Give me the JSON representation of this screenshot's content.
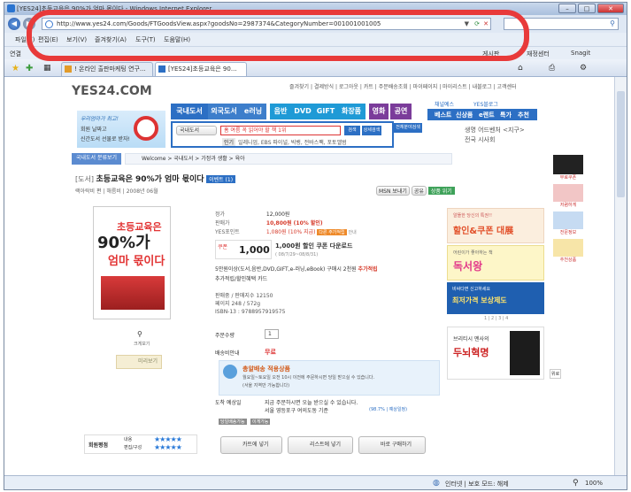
{
  "window": {
    "title": "[YES24]초등교육은 90%가 엄마 몫이다 - Windows Internet Explorer",
    "address": "http://www.yes24.com/Goods/FTGoodsView.aspx?goodsNo=2987374&CategoryNumber=001001001005"
  },
  "menu": [
    "파일(F)",
    "편집(E)",
    "보기(V)",
    "즐겨찾기(A)",
    "도구(T)",
    "도움말(H)"
  ],
  "links_label": "연결",
  "toolbar_right": [
    "게시판",
    "재정센터",
    "Snagit"
  ],
  "tabs": [
    "! 온라인 출판마케팅 연구...",
    "[YES24]초등교육은 90..."
  ],
  "site": {
    "logo": "YES24.COM",
    "top_links": [
      "즐겨찾기",
      "결제방식",
      "로그아웃",
      "카트",
      "주문배송조회",
      "마이페이지",
      "마이리스트",
      "내블로그",
      "고객센터"
    ],
    "banner_text1": "우리엄마가 최고!",
    "banner_text2": "회원 날짜고",
    "banner_text3": "신간도서 선물로 받자!",
    "nav_main": [
      "국내도서",
      "외국도서",
      "e러닝",
      "음반",
      "DVD",
      "GIFT",
      "화장품",
      "영화",
      "공연"
    ],
    "nav_sub": [
      "베스트",
      "신상품",
      "e렌트",
      "특가",
      "추천"
    ],
    "nav_extra": [
      "채널예스",
      "YES블로그"
    ],
    "search_category": "국내도서",
    "search_value": "홈 여름 꼭 읽어야 할 책 1위",
    "search_btns": [
      "검색",
      "상세검색",
      "전체분야검색"
    ],
    "popular_label": "인기",
    "popular_terms": "일레니엄, EBS 파이널, 빅뱅, 전바스팩, 포토앨범",
    "side_promo1": "생명 어드벤처 <지구>",
    "side_promo2": "전국 시사회",
    "cat_button": "국내도서 분류보기",
    "breadcrumb": [
      "Welcome",
      "국내도서",
      "가정과 생활",
      "육아"
    ],
    "book_type": "[도서]",
    "book_title": "초등교육은 90%가 엄마 몫이다",
    "event_badge": "이벤트 (1)",
    "author_line": "랙아락비 편 | 해름비 | 2008년 06월",
    "my_buttons": [
      "MSN 보내기",
      "공유",
      "상품 위기"
    ],
    "cover_title1": "초등교육은",
    "cover_title2": "90%가",
    "cover_title3": "엄마 몫이다",
    "zoom_label": "크게보기",
    "preview_label": "미리보기",
    "price_rows": [
      {
        "label": "정가",
        "value": "12,000원"
      },
      {
        "label": "판매가",
        "value": "10,800원 (10% 할인)"
      },
      {
        "label": "YES포인트",
        "value": "1,080원 (10% 지급)"
      }
    ],
    "point_badge": "다른 주가적립",
    "point_info": "안내",
    "coupon_box": "쿠폰",
    "coupon_amount": "1,000",
    "coupon_title": "1,000원 할인 쿠폰 다운로드",
    "coupon_period": "( 08/7/29~08/8/31)",
    "accrual_line1": "5만원이상(도서,음반,DVD,GIFT,e-러닝,eBook) 구매시 2천원",
    "accrual_bold": "추가적립",
    "accrual_line2": "추가적립/할인혜택 카드",
    "detail_lines": [
      "판매중 / 판매지수 12150",
      "페이지 248 / 572g",
      "ISBN-13 : 9788957919575"
    ],
    "qty_label": "주문수량",
    "qty_value": "1",
    "shipping_label": "배송비안내",
    "shipping_value": "무료",
    "free_ship_title": "총알배송 적용상품",
    "free_ship_desc1": "월요일~토요일 오전 10시 이전에 주문하시면 당일 받으실 수 있습니다.",
    "free_ship_desc2": "(서울 지역만 가능합니다)",
    "arrival_label": "도착 예상일",
    "arrival_line1": "지금 주문하시면 오늘 받으실 수 있습니다.",
    "arrival_line2": "서울 영등포구 여의도동 기준",
    "arrival_rate": "(98.7% | 예상일정)",
    "badges": [
      "당일배송가능",
      "이게가능"
    ],
    "rating_label": "회원평점",
    "rating_rows": [
      "내용",
      "편집/구성"
    ],
    "cart_buttons": [
      "카트에 넣기",
      "리스트에 넣기",
      "바로 구매하기"
    ],
    "right_ads": [
      {
        "line1": "알뜰한 당신의 특권!!",
        "line2": "할인&쿠폰 대展"
      },
      {
        "line1": "어린이가 좋아하는 책",
        "line2": "독서왕"
      },
      {
        "line1": "비싸다면 신고하세요",
        "line2": "최저가격 보상제도"
      },
      {
        "line1": "브리티시 멘사의",
        "line2": "두뇌혁명"
      }
    ],
    "ad_paging": "1 | 2 | 3 | 4",
    "far_right": [
      "무료쿠폰",
      "저렴하게",
      "전문정보",
      "추천상품"
    ],
    "top_btn": "위로"
  },
  "status": {
    "zone": "인터넷 | 보호 모드: 해제",
    "zoom": "100%"
  },
  "colors": {
    "brand_blue": "#2c6fc4",
    "price_red": "#d63a2a",
    "annotation_red": "#e83a3a",
    "nav_blue": "#3d7ecb",
    "nav_purple": "#7b3c9a"
  }
}
